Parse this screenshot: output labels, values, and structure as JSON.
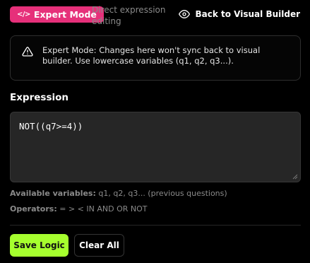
{
  "header": {
    "mode_badge_label": "Expert Mode",
    "mode_badge_icon": "code-icon",
    "mode_description": "Direct expression editing",
    "back_button_label": "Back to Visual Builder",
    "back_button_icon": "eye-icon"
  },
  "alert": {
    "icon": "warning-triangle-icon",
    "text": "Expert Mode: Changes here won't sync back to visual builder. Use lowercase variables (q1, q2, q3...)."
  },
  "expression": {
    "section_title": "Expression",
    "value": "NOT((q7>=4))"
  },
  "info": {
    "variables_label": "Available variables:",
    "variables_text": "q1, q2, q3... (previous questions)",
    "operators_label": "Operators:",
    "operators_text": "= > < IN AND OR NOT"
  },
  "actions": {
    "save_label": "Save Logic",
    "clear_label": "Clear All"
  },
  "colors": {
    "background": "#000000",
    "mode_badge": "#e6307a",
    "save_button": "#a6ff2e",
    "muted_text": "#8a8a8a",
    "input_background": "#262626"
  }
}
